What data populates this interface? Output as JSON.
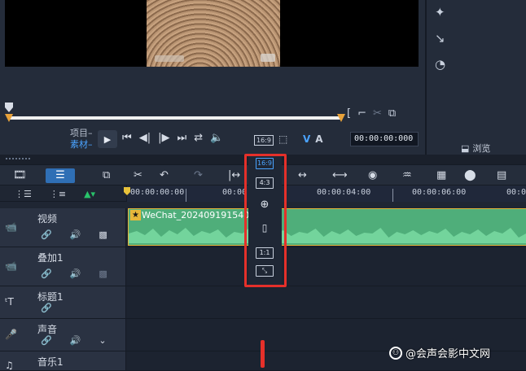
{
  "player": {
    "mode_project": "项目–",
    "mode_clip": "素材–",
    "timecode": "00:00:00:000",
    "aspect_small": "16:9",
    "va_v": "V",
    "va_a": "A"
  },
  "right_panel": {
    "browse_label": "浏览"
  },
  "ruler": {
    "labels": [
      "00:00:00:00",
      "00:00:0",
      "00:00:04:00",
      "00:00:06:00",
      "00:0"
    ]
  },
  "tracks": [
    {
      "name": "视频",
      "icon": "video-track-icon"
    },
    {
      "name": "叠加1",
      "icon": "overlay-track-icon"
    },
    {
      "name": "标题1",
      "icon": "title-track-icon"
    },
    {
      "name": "声音",
      "icon": "voice-track-icon"
    },
    {
      "name": "音乐1",
      "icon": "music-track-icon"
    }
  ],
  "clip": {
    "name": "WeChat_20240919154059.mp"
  },
  "aspect_popup": {
    "items": [
      "16:9",
      "4:3",
      "",
      "",
      "1:1",
      ""
    ],
    "selected": "16:9"
  },
  "watermark": {
    "text": "@会声会影中文网"
  },
  "colors": {
    "accent": "#4aa3ff",
    "clip_green": "#4fae7a",
    "highlight_red": "#e5302a",
    "toolbar_active": "#2f6fb5"
  }
}
